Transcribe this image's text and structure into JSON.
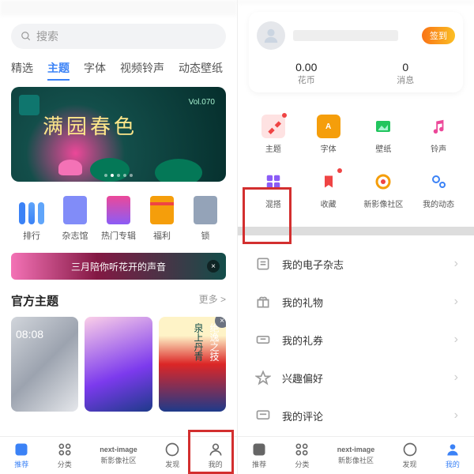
{
  "left": {
    "search_placeholder": "搜索",
    "tabs": [
      "精选",
      "主题",
      "字体",
      "视频铃声",
      "动态壁纸"
    ],
    "active_tab": 1,
    "banner": {
      "vol": "Vol.070",
      "title": "满园春色"
    },
    "cats": [
      {
        "label": "排行",
        "k": "rank"
      },
      {
        "label": "杂志馆",
        "k": "mag"
      },
      {
        "label": "热门专辑",
        "k": "hot"
      },
      {
        "label": "福利",
        "k": "gift"
      },
      {
        "label": "锁",
        "k": "more"
      }
    ],
    "mini_banner_text": "三月陪你听花开的声音",
    "section": {
      "title": "官方主题",
      "more": "更多 >"
    },
    "theme3_txt1": "绝逸之技",
    "theme3_txt2": "泉上丹青"
  },
  "right": {
    "sign_label": "签到",
    "stats": [
      {
        "value": "0.00",
        "label": "花币"
      },
      {
        "value": "0",
        "label": "消息"
      }
    ],
    "grid": [
      {
        "label": "主题",
        "k": "theme",
        "dot": true,
        "color": "#ef4444"
      },
      {
        "label": "字体",
        "k": "font",
        "dot": false,
        "color": "#f59e0b"
      },
      {
        "label": "壁纸",
        "k": "wall",
        "dot": false,
        "color": "#22c55e"
      },
      {
        "label": "铃声",
        "k": "ring",
        "dot": false,
        "color": "#ec4899"
      },
      {
        "label": "混搭",
        "k": "mix",
        "dot": false,
        "color": "#8b5cf6"
      },
      {
        "label": "收藏",
        "k": "fav",
        "dot": true,
        "color": "#ef4444"
      },
      {
        "label": "新影像社区",
        "k": "community",
        "dot": false,
        "color": "#06b6d4"
      },
      {
        "label": "我的动态",
        "k": "feed",
        "dot": false,
        "color": "#3b82f6"
      }
    ],
    "list": [
      {
        "label": "我的电子杂志",
        "k": "mag"
      },
      {
        "label": "我的礼物",
        "k": "gift"
      },
      {
        "label": "我的礼券",
        "k": "coupon"
      },
      {
        "label": "兴趣偏好",
        "k": "pref"
      },
      {
        "label": "我的评论",
        "k": "comment"
      }
    ]
  },
  "nav": [
    {
      "label": "推荐",
      "k": "rec"
    },
    {
      "label": "分类",
      "k": "cat"
    },
    {
      "label": "新影像社区",
      "k": "nextimage",
      "brand": "next-image"
    },
    {
      "label": "发现",
      "k": "find"
    },
    {
      "label": "我的",
      "k": "my"
    }
  ]
}
